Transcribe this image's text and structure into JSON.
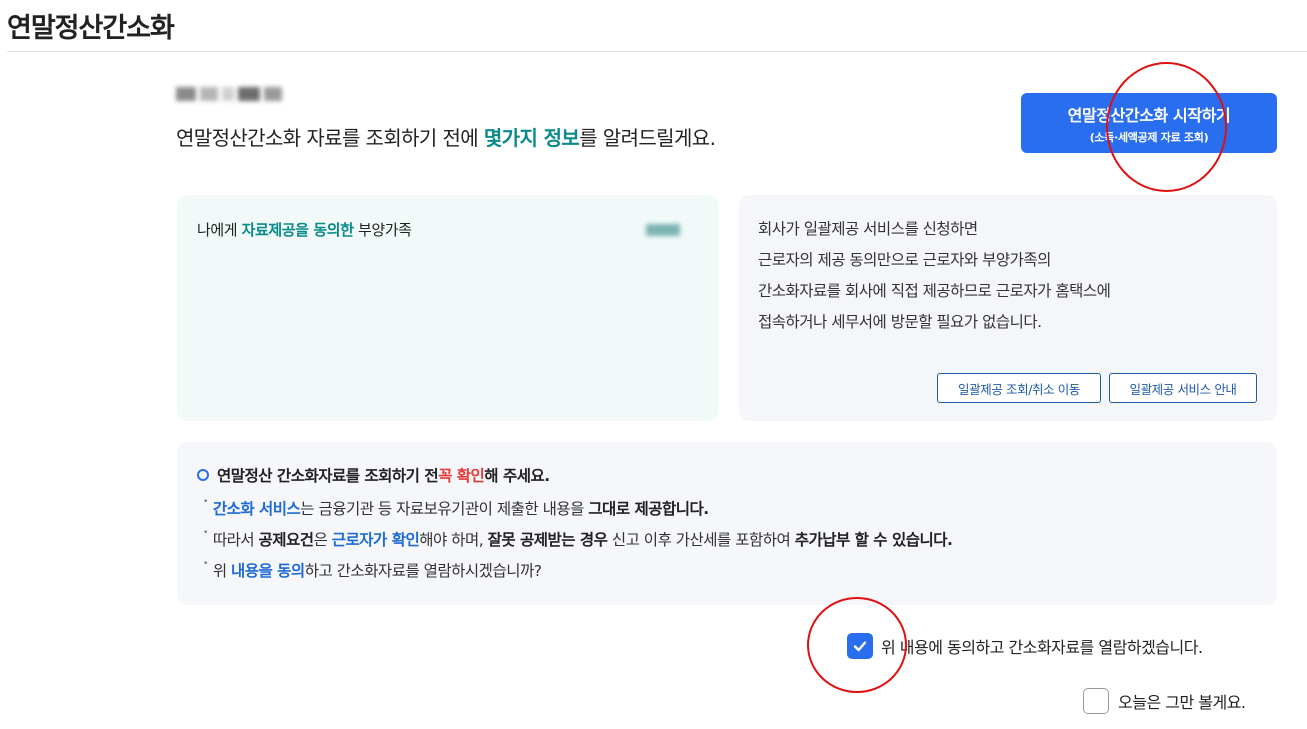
{
  "page": {
    "title": "연말정산간소화"
  },
  "intro": {
    "text_before": "연말정산간소화 자료를 조회하기 전에 ",
    "highlight": "몇가지 정보",
    "text_after": "를 알려드릴게요."
  },
  "start_button": {
    "line1": "연말정산간소화 시작하기",
    "line2": "(소득·세액공제 자료 조회)"
  },
  "left_card": {
    "title_before": "나에게 ",
    "title_highlight": "자료제공을 동의한",
    "title_after": " 부양가족"
  },
  "right_card": {
    "lines": [
      "회사가 일괄제공 서비스를 신청하면",
      "근로자의 제공 동의만으로 근로자와 부양가족의",
      "간소화자료를 회사에 직접 제공하므로 근로자가 홈택스에",
      "접속하거나 세무서에 방문할 필요가 없습니다."
    ],
    "buttons": [
      "일괄제공 조회/취소 이동",
      "일괄제공 서비스 안내"
    ]
  },
  "notice": {
    "head_before": "연말정산 간소화자료를 조회하기 전 ",
    "head_highlight": "꼭 확인",
    "head_after": "해 주세요.",
    "line1": {
      "a": "간소화 서비스",
      "b": "는 금융기관 등 자료보유기관이 제출한 내용을 ",
      "c": "그대로 제공합니다."
    },
    "line2": {
      "a": "따라서 ",
      "b": "공제요건",
      "c": "은 ",
      "d": "근로자가 확인",
      "e": "해야 하며, ",
      "f": "잘못 공제받는 경우",
      "g": " 신고 이후 가산세를 포함하여 ",
      "h": "추가납부 할 수 있습니다."
    },
    "line3": {
      "a": "위 ",
      "b": "내용을 동의",
      "c": "하고 간소화자료를 열람하시겠습니까?"
    }
  },
  "agree": {
    "label": "위 내용에 동의하고 간소화자료를 열람하겠습니다.",
    "checked": true
  },
  "today": {
    "label": "오늘은 그만 볼게요.",
    "checked": false
  },
  "colors": {
    "accent": "#2a6ef0",
    "teal": "#0a8a8a",
    "red": "#e53935",
    "annotation": "#e01010"
  },
  "icons": {
    "checkbox_checked": "check-icon",
    "notice_bullet": "ring-icon"
  }
}
